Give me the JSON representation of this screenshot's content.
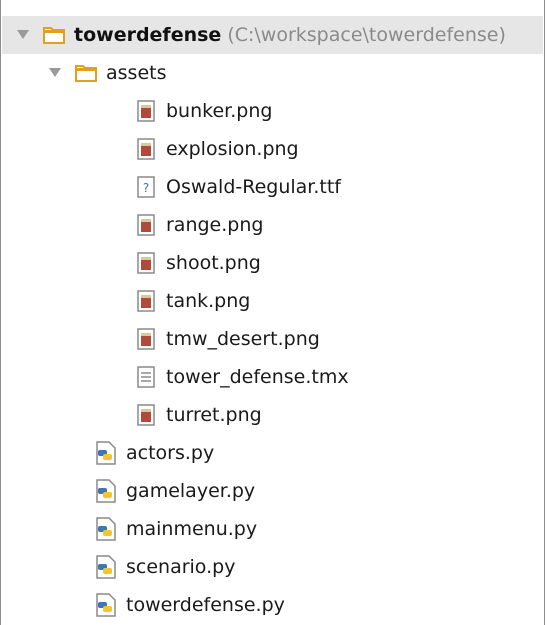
{
  "project": {
    "name": "towerdefense",
    "path": "(C:\\workspace\\towerdefense)"
  },
  "assets_folder": {
    "label": "assets",
    "files": [
      {
        "label": "bunker.png",
        "icon": "image-file-icon"
      },
      {
        "label": "explosion.png",
        "icon": "image-file-icon"
      },
      {
        "label": "Oswald-Regular.ttf",
        "icon": "unknown-file-icon"
      },
      {
        "label": "range.png",
        "icon": "image-file-icon"
      },
      {
        "label": "shoot.png",
        "icon": "image-file-icon"
      },
      {
        "label": "tank.png",
        "icon": "image-file-icon"
      },
      {
        "label": "tmw_desert.png",
        "icon": "image-file-icon"
      },
      {
        "label": "tower_defense.tmx",
        "icon": "text-file-icon"
      },
      {
        "label": "turret.png",
        "icon": "image-file-icon"
      }
    ]
  },
  "python_files": [
    {
      "label": "actors.py"
    },
    {
      "label": "gamelayer.py"
    },
    {
      "label": "mainmenu.py"
    },
    {
      "label": "scenario.py"
    },
    {
      "label": "towerdefense.py"
    }
  ],
  "colors": {
    "folder": "#e0a020",
    "selection": "#e6e6e6",
    "path_text": "#8a8a8a",
    "python_blue": "#3b77b5",
    "python_yellow": "#f2c533"
  }
}
